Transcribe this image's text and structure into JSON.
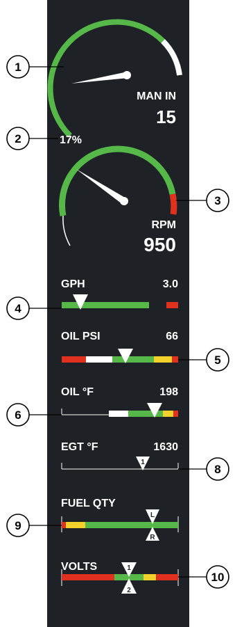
{
  "callouts": [
    "1",
    "2",
    "3",
    "4",
    "5",
    "6",
    "8",
    "9",
    "10"
  ],
  "colors": {
    "panel": "#1e2226",
    "green": "#55b848",
    "white": "#ffffff",
    "yellow": "#f2d22a",
    "red": "#e0301e",
    "pointer": "#ffffff"
  },
  "manifold": {
    "label": "MAN IN",
    "value": "15",
    "percent": "17%"
  },
  "rpm": {
    "label": "RPM",
    "value": "950"
  },
  "gph": {
    "label": "GPH",
    "value": "3.0"
  },
  "oil_psi": {
    "label": "OIL PSI",
    "value": "66"
  },
  "oil_temp": {
    "label": "OIL °F",
    "value": "198"
  },
  "egt": {
    "label": "EGT °F",
    "value": "1630",
    "pointer_tag": "1"
  },
  "fuel_qty": {
    "label": "FUEL QTY",
    "left_tag": "L",
    "right_tag": "R"
  },
  "volts": {
    "label": "VOLTS",
    "top_tag": "1",
    "bottom_tag": "2"
  }
}
